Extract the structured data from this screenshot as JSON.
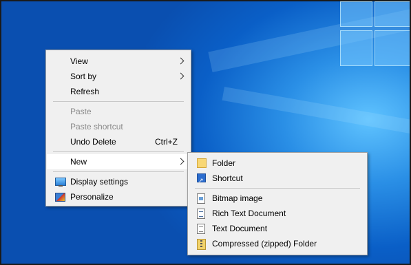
{
  "context_menu": {
    "items": [
      {
        "label": "View",
        "has_submenu": true
      },
      {
        "label": "Sort by",
        "has_submenu": true
      },
      {
        "label": "Refresh"
      },
      {
        "label": "Paste",
        "disabled": true
      },
      {
        "label": "Paste shortcut",
        "disabled": true
      },
      {
        "label": "Undo Delete",
        "shortcut": "Ctrl+Z"
      },
      {
        "label": "New",
        "has_submenu": true,
        "highlighted": true
      },
      {
        "label": "Display settings",
        "icon": "display-icon"
      },
      {
        "label": "Personalize",
        "icon": "personalize-icon"
      }
    ]
  },
  "new_submenu": {
    "items": [
      {
        "label": "Folder",
        "icon": "folder-icon"
      },
      {
        "label": "Shortcut",
        "icon": "shortcut-icon"
      },
      {
        "label": "Bitmap image",
        "icon": "bitmap-icon"
      },
      {
        "label": "Rich Text Document",
        "icon": "rtf-icon"
      },
      {
        "label": "Text Document",
        "icon": "text-document-icon"
      },
      {
        "label": "Compressed (zipped) Folder",
        "icon": "zip-folder-icon"
      }
    ]
  },
  "colors": {
    "menu_bg": "#f0f0f0",
    "highlight": "#ffffff",
    "disabled_text": "#8a8a8a",
    "desktop_blue": "#0a5fc7"
  }
}
